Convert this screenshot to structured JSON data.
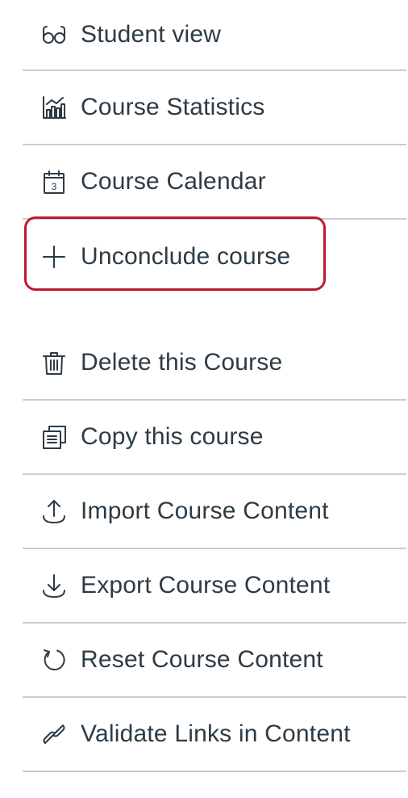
{
  "menu": {
    "items": [
      {
        "label": "Student view",
        "icon": "glasses-icon"
      },
      {
        "label": "Course Statistics",
        "icon": "statistics-icon"
      },
      {
        "label": "Course Calendar",
        "icon": "calendar-icon",
        "calendar_day": "3"
      },
      {
        "label": "Unconclude course",
        "icon": "plus-icon",
        "highlighted": true
      },
      {
        "label": "Delete this Course",
        "icon": "trash-icon"
      },
      {
        "label": "Copy this course",
        "icon": "copy-icon"
      },
      {
        "label": "Import Course Content",
        "icon": "upload-icon"
      },
      {
        "label": "Export Course Content",
        "icon": "download-icon"
      },
      {
        "label": "Reset Course Content",
        "icon": "reset-icon"
      },
      {
        "label": "Validate Links in Content",
        "icon": "link-icon"
      }
    ]
  },
  "colors": {
    "text": "#2d3b45",
    "divider": "#c7cdd1",
    "highlight": "#c0192d"
  }
}
